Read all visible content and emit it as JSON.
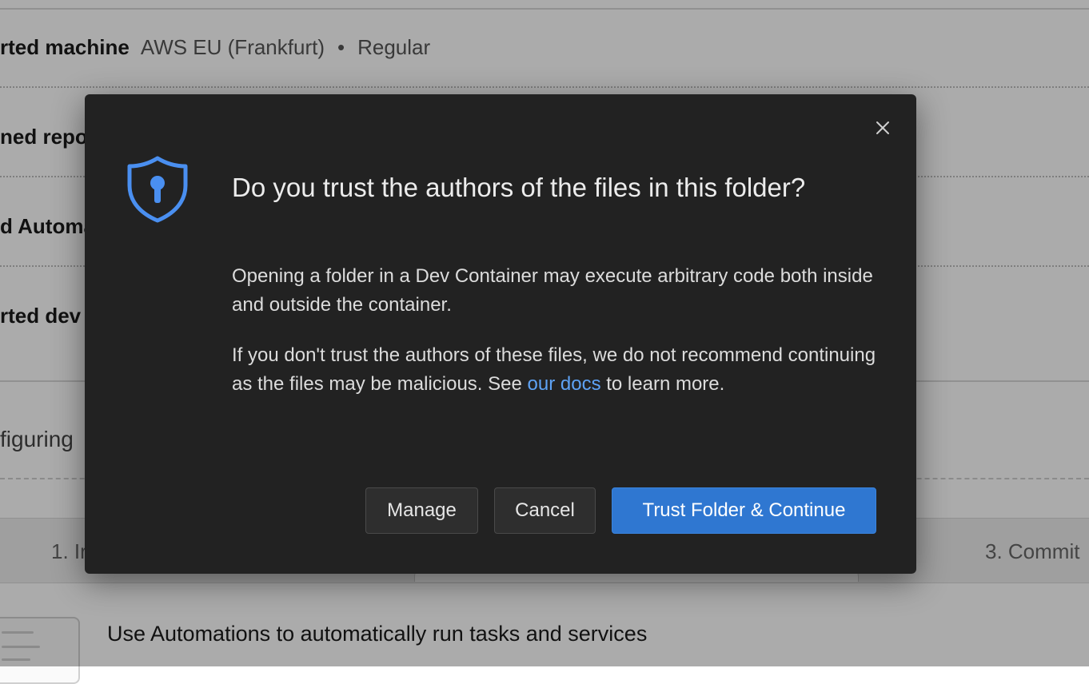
{
  "background": {
    "machine_row": {
      "label": "rted machine",
      "region": "AWS EU (Frankfurt)",
      "separator": "•",
      "class": "Regular"
    },
    "rows": [
      "ned repo",
      "d Automa",
      "rted dev"
    ],
    "configuring": "figuring",
    "steps": {
      "step1": "1. Ir",
      "step3": "3. Commit"
    },
    "automations_text": "Use Automations to automatically run tasks and services"
  },
  "dialog": {
    "title": "Do you trust the authors of the files in this folder?",
    "paragraph1": "Opening a folder in a Dev Container may execute arbitrary code both inside and outside the container.",
    "paragraph2_before": "If you don't trust the authors of these files, we do not recommend continuing as the files may be malicious. See ",
    "paragraph2_link": "our docs",
    "paragraph2_after": " to learn more.",
    "buttons": {
      "manage": "Manage",
      "cancel": "Cancel",
      "trust": "Trust Folder & Continue"
    },
    "icons": {
      "close": "close-icon",
      "shield": "shield-lock-icon"
    },
    "colors": {
      "accent": "#2f77d1",
      "link": "#5ea2f4",
      "dialog_bg": "#222222",
      "shield": "#4a8ff0"
    }
  }
}
